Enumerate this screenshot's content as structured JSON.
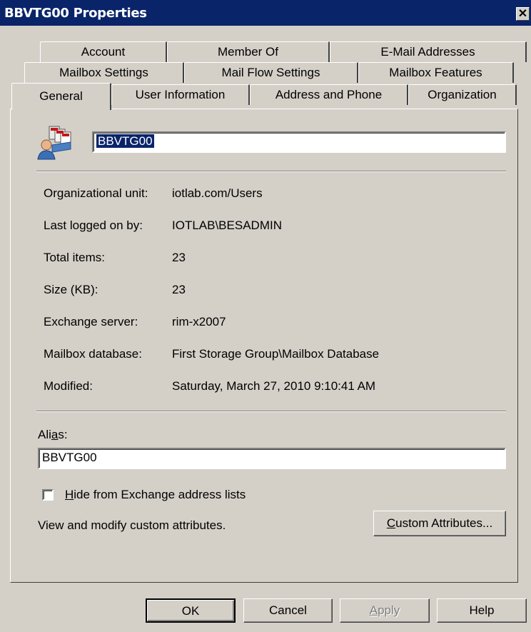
{
  "window": {
    "title": "BBVTG00 Properties",
    "close_glyph": "✕"
  },
  "tabs": {
    "row1": [
      "Account",
      "Member Of",
      "E-Mail Addresses"
    ],
    "row2": [
      "Mailbox Settings",
      "Mail Flow Settings",
      "Mailbox Features"
    ],
    "row3": [
      "General",
      "User Information",
      "Address and Phone",
      "Organization"
    ],
    "active": "General"
  },
  "general": {
    "icon": "mailbox-user-icon",
    "display_name": "BBVTG00",
    "fields": [
      {
        "label": "Organizational unit:",
        "value": "iotlab.com/Users"
      },
      {
        "label": "Last logged on by:",
        "value": "IOTLAB\\BESADMIN"
      },
      {
        "label": "Total items:",
        "value": "23"
      },
      {
        "label": "Size (KB):",
        "value": "23"
      },
      {
        "label": "Exchange server:",
        "value": "rim-x2007"
      },
      {
        "label": "Mailbox database:",
        "value": "First Storage Group\\Mailbox Database"
      },
      {
        "label": "Modified:",
        "value": "Saturday, March 27, 2010 9:10:41 AM"
      }
    ],
    "alias_label_pre": "Ali",
    "alias_label_acc": "a",
    "alias_label_post": "s:",
    "alias_value": "BBVTG00",
    "hide_acc": "H",
    "hide_rest": "ide from Exchange address lists",
    "hide_checked": false,
    "custom_text": "View and modify custom attributes.",
    "custom_btn_acc": "C",
    "custom_btn_rest": "ustom Attributes..."
  },
  "buttons": {
    "ok": "OK",
    "cancel": "Cancel",
    "apply_acc": "A",
    "apply_rest": "pply",
    "help": "Help"
  }
}
